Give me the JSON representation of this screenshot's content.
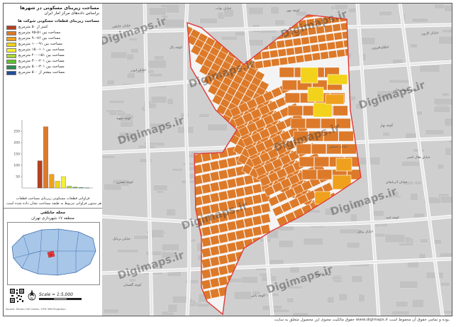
{
  "title_line1": "مساحت زیربنای مسکونی در شهرها",
  "title_line2": "براساس داده‌های مرکز آمار ایران",
  "legend_title": "مساحت زیربنای قطعات مسکونی شوکت ها",
  "legend": [
    {
      "label": "کمتر از ۵۰ مترمربع",
      "color": "#b5401f"
    },
    {
      "label": "مساحت بین ۵۱-۷۵ مترمربع",
      "color": "#dc7a2a"
    },
    {
      "label": "مساحت بین ۷۶-۹۰ مترمربع",
      "color": "#efa11d"
    },
    {
      "label": "مساحت بین ۹۱-۱۰۰ مترمربع",
      "color": "#f2d21a"
    },
    {
      "label": "مساحت بین ۱۰۱-۱۵۰ مترمربع",
      "color": "#f5ef37"
    },
    {
      "label": "مساحت بین ۱۵۱-۲۰۰ مترمربع",
      "color": "#a9d838"
    },
    {
      "label": "مساحت بین ۲۰۱-۳۰۰ مترمربع",
      "color": "#5fc12a"
    },
    {
      "label": "مساحت بین ۳۰۱-۵۰۰ مترمربع",
      "color": "#2a8a52"
    },
    {
      "label": "مساحت بیشتر از ۵۰۰ مترمربع",
      "color": "#244a9a"
    }
  ],
  "chart_data": {
    "type": "bar",
    "categories": [
      "<50",
      "51-75",
      "76-90",
      "91-100",
      "101-150",
      "151-200",
      "201-300",
      "301-500",
      ">500"
    ],
    "values": [
      120,
      270,
      60,
      30,
      50,
      8,
      4,
      2,
      1
    ],
    "ylim": [
      0,
      300
    ],
    "yticks": [
      50,
      100,
      150,
      200,
      250
    ],
    "colors": [
      "#b5401f",
      "#dc7a2a",
      "#efa11d",
      "#f2d21a",
      "#f5ef37",
      "#a9d838",
      "#5fc12a",
      "#2a8a52",
      "#244a9a"
    ],
    "caption1": "فراوانی قطعات مسکونی زیربنای مساحت قطعات",
    "caption2": "بالای هر ستون فراوانی مربوط به طبقه مساحت نشان داده شده است"
  },
  "inset_title": "محله جابلقی",
  "inset_subtitle": "منطقه ۱۷ شهرداری تهران",
  "scale_text": "Scale = 1:5,000",
  "credit_text": "Source: Tehran GIS Center, UTM 39N Projection",
  "footer_text": "حقوق مالکیت معنوی این محصول متعلق به سایت www.digimaps.ir بوده و تمامی حقوق آن محفوظ است.",
  "watermarks": [
    "Digimaps.ir",
    "Digimaps.ir",
    "Digimaps.ir",
    "Digimaps.ir",
    "Digimaps.ir",
    "Digimaps.ir",
    "Digimaps.ir",
    "Digimaps.ir",
    "Digimaps.ir",
    "Digimaps.ir"
  ],
  "street_labels": [
    "خیابان جابلقی",
    "خیابان ابوذر",
    "کوچه شهید",
    "خیابان قزوین",
    "خیابان شهید رجایی",
    "کوچه بهار",
    "خیابان آذربایجان",
    "کوچه نسترن",
    "خیابان بریانک",
    "کوچه گلستان",
    "خیابان مالک",
    "کوچه امید",
    "خیابان کمیل",
    "کوچه یاس",
    "خیابان هلال احمر",
    "خیابان نواب",
    "کوچه مهر",
    "خیابان جیحون",
    "کوچه پاک",
    "خیابان کارون"
  ],
  "colors": {
    "parcel_main": "#dc7a2a",
    "parcel_edge": "#ffffff",
    "boundary": "#e23b3b",
    "map_bg": "#cfcfcf"
  }
}
